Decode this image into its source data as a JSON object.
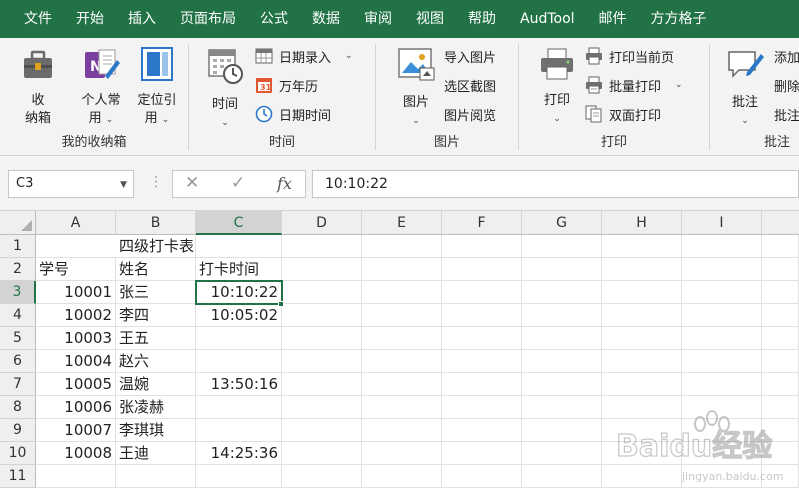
{
  "menu": [
    "文件",
    "开始",
    "插入",
    "页面布局",
    "公式",
    "数据",
    "审阅",
    "视图",
    "帮助",
    "AudTool",
    "邮件",
    "方方格子"
  ],
  "ribbon": {
    "group1": {
      "label": "我的收纳箱",
      "btn_box": "收\n纳箱",
      "btn_box_l1": "收",
      "btn_box_l2": "纳箱",
      "btn_personal_l1": "个人常",
      "btn_personal_l2": "用",
      "btn_locate_l1": "定位引",
      "btn_locate_l2": "用"
    },
    "group2": {
      "label": "时间",
      "btn_time": "时间",
      "date_entry": "日期录入",
      "calendar": "万年历",
      "date_time": "日期时间"
    },
    "group3": {
      "label": "图片",
      "btn_picture": "图片",
      "import_pic": "导入图片",
      "select_capture": "选区截图",
      "pic_browse": "图片阅览"
    },
    "group4": {
      "label": "打印",
      "btn_print": "打印",
      "print_current": "打印当前页",
      "batch_print": "批量打印",
      "duplex_print": "双面打印"
    },
    "group5": {
      "label": "批注",
      "btn_comment": "批注",
      "add": "添加",
      "delete": "删除",
      "batch": "批注"
    }
  },
  "formula_bar": {
    "name_box": "C3",
    "cancel": "✕",
    "enter": "✓",
    "fx": "fx",
    "formula": "10:10:22"
  },
  "columns": [
    "A",
    "B",
    "C",
    "D",
    "E",
    "F",
    "G",
    "H",
    "I"
  ],
  "rows": [
    "1",
    "2",
    "3",
    "4",
    "5",
    "6",
    "7",
    "8",
    "9",
    "10",
    "11"
  ],
  "sheet": {
    "title": "四级打卡表",
    "headers": [
      "学号",
      "姓名",
      "打卡时间"
    ],
    "records": [
      {
        "id": "10001",
        "name": "张三",
        "time": "10:10:22"
      },
      {
        "id": "10002",
        "name": "李四",
        "time": "10:05:02"
      },
      {
        "id": "10003",
        "name": "王五",
        "time": ""
      },
      {
        "id": "10004",
        "name": "赵六",
        "time": ""
      },
      {
        "id": "10005",
        "name": "温婉",
        "time": "13:50:16"
      },
      {
        "id": "10006",
        "name": "张凌赫",
        "time": ""
      },
      {
        "id": "10007",
        "name": "李琪琪",
        "time": ""
      },
      {
        "id": "10008",
        "name": "王迪",
        "time": "14:25:36"
      }
    ]
  },
  "watermark": {
    "brand": "Baidu经验",
    "url": "jingyan.baidu.com"
  },
  "colors": {
    "accent": "#217346",
    "ribbon_bg": "#f3f3f3",
    "header_bg": "#efefef"
  }
}
